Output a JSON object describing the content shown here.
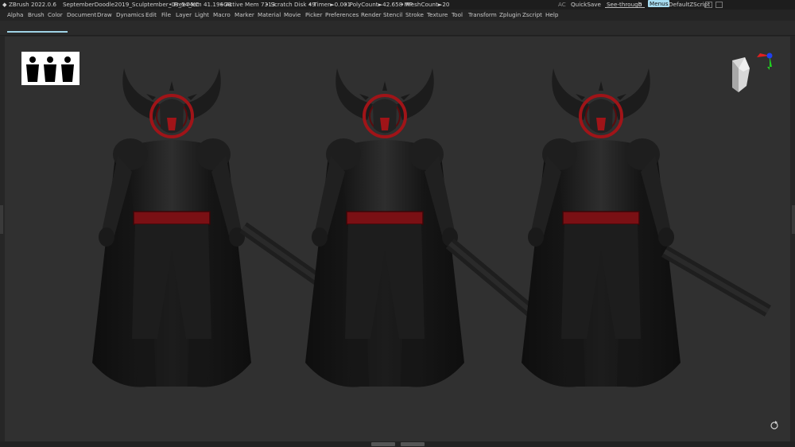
{
  "titlebar": {
    "app": "ZBrush 2022.0.6",
    "filename": "SeptemberDoodle2019_Sculptember_08_54_KC",
    "free_mem": "• Free Mem 41.196GB",
    "active_mem": "• Active Mem 7313",
    "scratch_disk": "• Scratch Disk 49",
    "timer": "• Timer►0.001",
    "polycount": "• PolyCount►42.658 MP",
    "meshcount": "• MeshCount►20",
    "ac": "AC",
    "quicksave": "QuickSave",
    "see_through_label": "See-through",
    "see_through_value": "0",
    "menus": "Menus",
    "default_zscript": "DefaultZScript"
  },
  "menu": {
    "items": [
      "Alpha",
      "Brush",
      "Color",
      "Document",
      "Draw",
      "Dynamics",
      "Edit",
      "File",
      "Layer",
      "Light",
      "Macro",
      "Marker",
      "Material",
      "Movie",
      "Picker",
      "Preferences",
      "Render",
      "Stencil",
      "Stroke",
      "Texture",
      "Tool",
      "Transform",
      "Zplugin",
      "Zscript",
      "Help"
    ]
  },
  "colors": {
    "accent": "#9fd3e6",
    "canvas": "#303030",
    "menus_button": "#a6dcf0",
    "armor_red": "#a01418",
    "gizmo_red": "#e02020",
    "gizmo_green": "#20d020",
    "gizmo_blue": "#2040f0"
  },
  "icons": {
    "thumbnail": "silhouette-thumbnail-icon",
    "navigation": "head-navigation-icon",
    "gizmo": "axis-gizmo-icon",
    "rotate": "rotate-icon"
  }
}
